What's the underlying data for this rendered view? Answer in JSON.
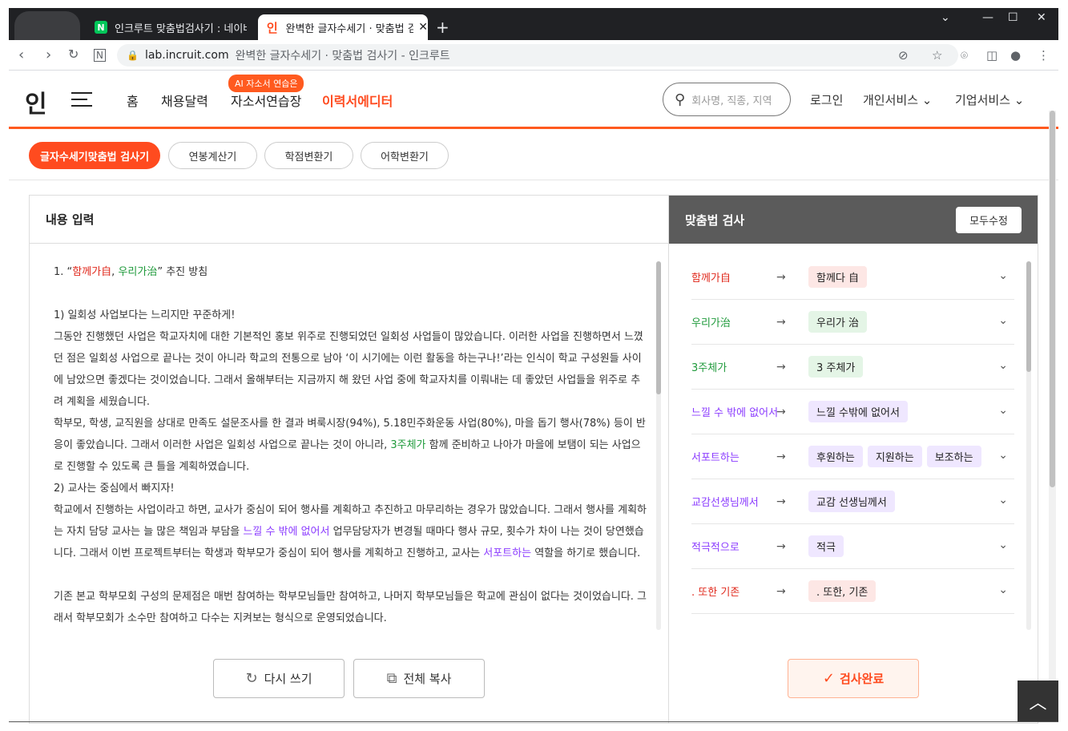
{
  "browser": {
    "tabs": [
      {
        "title": "인크루트 맞춤법검사기 : 네이버",
        "favicon": "N",
        "active": false
      },
      {
        "title": "완벽한 글자수세기 · 맞춤법 검사",
        "favicon": "인",
        "active": true
      }
    ],
    "new_tab": "+",
    "url_host": "lab.incruit.com",
    "url_title": "완벽한 글자수세기 · 맞춤법 검사기 - 인크루트"
  },
  "header": {
    "logo": "인",
    "nav": [
      "홈",
      "채용달력",
      "자소서연습장",
      "이력서에디터"
    ],
    "ai_badge": "AI 자소서 연습은",
    "search_placeholder": "회사명, 직종, 지역",
    "login": "로그인",
    "personal": "개인서비스",
    "business": "기업서비스"
  },
  "subnav": {
    "chips": [
      "글자수세기맞춤법 검사기",
      "연봉계산기",
      "학점변환기",
      "어학변환기"
    ]
  },
  "left": {
    "title": "내용 입력",
    "line1_prefix": "1. “",
    "line1_red": "함께가自",
    "line1_sep": ", ",
    "line1_green": "우리가治",
    "line1_suffix": "” 추진 방침",
    "p2": "1) 일회성 사업보다는 느리지만 꾸준하게!",
    "p3": "그동안 진행했던 사업은 학교자치에 대한 기본적인 홍보 위주로 진행되었던 일회성 사업들이 많았습니다. 이러한 사업을 진행하면서 느꼈던 점은 일회성 사업으로 끝나는 것이 아니라 학교의 전통으로 남아 ‘이 시기에는 이런 활동을 하는구나!’라는 인식이 학교 구성원들 사이에 남았으면 좋겠다는 것이었습니다. 그래서 올해부터는 지금까지 해 왔던 사업 중에 학교자치를 이뤄내는 데 좋았던 사업들을 위주로 추려 계획을 세웠습니다.",
    "p4_a": "학부모, 학생, 교직원을 상대로 만족도 설문조사를 한 결과 벼룩시장(94%), 5.18민주화운동 사업(80%), 마을 돕기 행사(78%) 등이 반응이 좋았습니다. 그래서 이러한 사업은 일회성 사업으로 끝나는 것이 아니라, ",
    "p4_green": "3주체가",
    "p4_b": " 함께 준비하고 나아가 마을에 보탬이 되는 사업으로 진행할 수 있도록 큰 틀을 계획하였습니다.",
    "p5": "2) 교사는 중심에서 빠지자!",
    "p6_a": "학교에서 진행하는 사업이라고 하면, 교사가 중심이 되어 행사를 계획하고 추진하고 마무리하는 경우가 많았습니다. 그래서 행사를 계획하는 자치 담당 교사는 늘 많은 책임과 부담을 ",
    "p6_purple": "느낄 수 밖에 없어서",
    "p6_b": " 업무담당자가 변경될 때마다 행사 규모, 횟수가 차이 나는 것이 당연했습니다. 그래서 이번 프로젝트부터는 학생과 학부모가 중심이 되어 행사를 계획하고 진행하고, 교사는 ",
    "p6_purple2": "서포트하는",
    "p6_c": " 역할을 하기로 했습니다.",
    "p7": "기존 본교 학부모회 구성의 문제점은 매번 참여하는 학부모님들만 참여하고, 나머지 학부모님들은 학교에 관심이 없다는 것이었습니다. 그래서 학부모회가 소수만 참여하고 다수는 지켜보는 형식으로 운영되었습니다.",
    "rewrite": "다시 쓰기",
    "copy_all": "전체 복사"
  },
  "right": {
    "title": "맞춤법 검사",
    "fix_all": "모두수정",
    "items": [
      {
        "orig": "함께가自",
        "color": "red",
        "suggestions": [
          "함께다 自"
        ]
      },
      {
        "orig": "우리가治",
        "color": "green",
        "suggestions": [
          "우리가 治"
        ]
      },
      {
        "orig": "3주체가",
        "color": "green",
        "suggestions": [
          "3 주체가"
        ]
      },
      {
        "orig": "느낄 수 밖에 없어서",
        "color": "purple",
        "suggestions": [
          "느낄 수밖에 없어서"
        ]
      },
      {
        "orig": "서포트하는",
        "color": "purple",
        "suggestions": [
          "후원하는",
          "지원하는",
          "보조하는"
        ]
      },
      {
        "orig": "교감선생님께서",
        "color": "purple",
        "suggestions": [
          "교감 선생님께서"
        ]
      },
      {
        "orig": "적극적으로",
        "color": "purple",
        "suggestions": [
          "적극"
        ]
      },
      {
        "orig": ". 또한 기존",
        "color": "red",
        "suggestions": [
          ". 또한, 기존"
        ]
      }
    ],
    "done": "검사완료"
  },
  "colors": {
    "accent": "#ff4b1f",
    "red": "#e0291c",
    "green": "#1f9a3b",
    "purple": "#8b3bff"
  }
}
